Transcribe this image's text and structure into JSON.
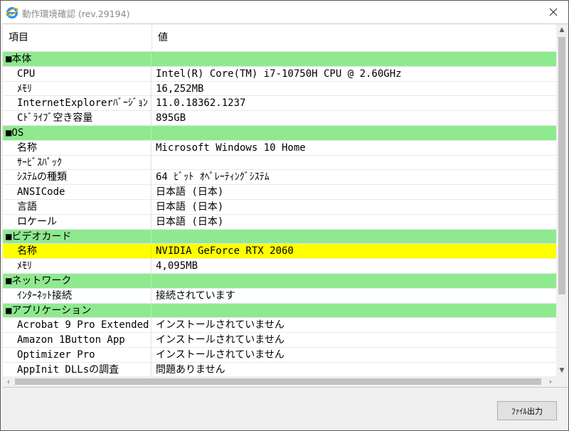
{
  "window": {
    "title": "動作環境確認 (rev.29194)",
    "close_label": "×"
  },
  "table": {
    "headers": [
      "項目",
      "値"
    ],
    "rows": [
      {
        "type": "section",
        "item": "■本体",
        "value": ""
      },
      {
        "type": "data",
        "item": "CPU",
        "value": "Intel(R) Core(TM) i7-10750H CPU @ 2.60GHz"
      },
      {
        "type": "data",
        "item": "ﾒﾓﾘ",
        "value": "16,252MB"
      },
      {
        "type": "data",
        "item": "InternetExplorerﾊﾞｰｼﾞｮﾝ",
        "value": "11.0.18362.1237"
      },
      {
        "type": "data",
        "item": "Cﾄﾞﾗｲﾌﾞ空き容量",
        "value": "895GB"
      },
      {
        "type": "section",
        "item": "■OS",
        "value": ""
      },
      {
        "type": "data",
        "item": "名称",
        "value": "Microsoft Windows 10 Home"
      },
      {
        "type": "data",
        "item": "ｻｰﾋﾞｽﾊﾟｯｸ",
        "value": ""
      },
      {
        "type": "data",
        "item": "ｼｽﾃﾑの種類",
        "value": "64 ﾋﾞｯﾄ ｵﾍﾟﾚｰﾃｨﾝｸﾞｼｽﾃﾑ"
      },
      {
        "type": "data",
        "item": "ANSICode",
        "value": "日本語 (日本)"
      },
      {
        "type": "data",
        "item": "言語",
        "value": "日本語 (日本)"
      },
      {
        "type": "data",
        "item": "ロケール",
        "value": "日本語 (日本)"
      },
      {
        "type": "section",
        "item": "■ビデオカード",
        "value": ""
      },
      {
        "type": "highlight",
        "item": "名称",
        "value": "NVIDIA GeForce RTX 2060"
      },
      {
        "type": "data",
        "item": "ﾒﾓﾘ",
        "value": "4,095MB"
      },
      {
        "type": "section",
        "item": "■ネットワーク",
        "value": ""
      },
      {
        "type": "data",
        "item": "ｲﾝﾀｰﾈｯﾄ接続",
        "value": "接続されています"
      },
      {
        "type": "section",
        "item": "■アプリケーション",
        "value": ""
      },
      {
        "type": "data",
        "item": "Acrobat 9 Pro Extended",
        "value": "インストールされていません"
      },
      {
        "type": "data",
        "item": "Amazon 1Button App",
        "value": "インストールされていません"
      },
      {
        "type": "data",
        "item": "Optimizer Pro",
        "value": "インストールされていません"
      },
      {
        "type": "data",
        "item": "AppInit DLLsの調査",
        "value": "問題ありません"
      }
    ]
  },
  "footer": {
    "export_label": "ﾌｧｲﾙ出力"
  },
  "colors": {
    "section_bg": "#8fe98f",
    "highlight_bg": "#ffff00",
    "app_icon": "#1e90ff"
  },
  "icons": {
    "app": "internet-explorer-icon",
    "close": "close-icon"
  }
}
